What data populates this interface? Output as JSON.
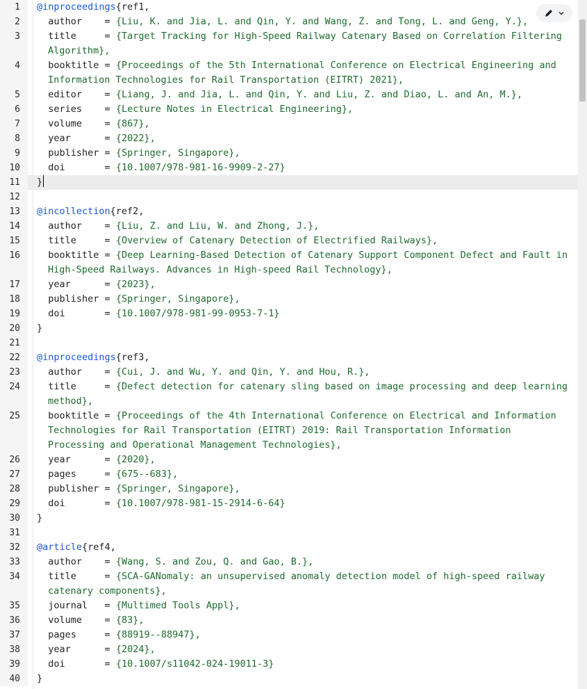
{
  "lines": [
    {
      "n": "1",
      "segs": [
        [
          "tag",
          "@inproceedings"
        ],
        [
          "brace",
          "{ref1,"
        ]
      ]
    },
    {
      "n": "2",
      "segs": [
        [
          "key",
          "  author    "
        ],
        [
          "brace",
          "= "
        ],
        [
          "val",
          "{Liu, K. and Jia, L. and Qin, Y. and Wang, Z. and Tong, L. and Geng, Y.},"
        ]
      ]
    },
    {
      "n": "3",
      "segs": [
        [
          "key",
          "  title     "
        ],
        [
          "brace",
          "= "
        ],
        [
          "val",
          "{Target Tracking for High-Speed Railway Catenary Based on Correlation Filtering"
        ]
      ]
    },
    {
      "n": "",
      "cont": true,
      "segs": [
        [
          "val",
          "Algorithm},"
        ]
      ]
    },
    {
      "n": "4",
      "segs": [
        [
          "key",
          "  booktitle "
        ],
        [
          "brace",
          "= "
        ],
        [
          "val",
          "{Proceedings of the 5th International Conference on Electrical Engineering and"
        ]
      ]
    },
    {
      "n": "",
      "cont": true,
      "segs": [
        [
          "val",
          "Information Technologies for Rail Transportation (EITRT) 2021},"
        ]
      ]
    },
    {
      "n": "5",
      "segs": [
        [
          "key",
          "  editor    "
        ],
        [
          "brace",
          "= "
        ],
        [
          "val",
          "{Liang, J. and Jia, L. and Qin, Y. and Liu, Z. and Diao, L. and An, M.},"
        ]
      ]
    },
    {
      "n": "6",
      "segs": [
        [
          "key",
          "  series    "
        ],
        [
          "brace",
          "= "
        ],
        [
          "val",
          "{Lecture Notes in Electrical Engineering},"
        ]
      ]
    },
    {
      "n": "7",
      "segs": [
        [
          "key",
          "  volume    "
        ],
        [
          "brace",
          "= "
        ],
        [
          "val",
          "{867},"
        ]
      ]
    },
    {
      "n": "8",
      "segs": [
        [
          "key",
          "  year      "
        ],
        [
          "brace",
          "= "
        ],
        [
          "val",
          "{2022},"
        ]
      ]
    },
    {
      "n": "9",
      "segs": [
        [
          "key",
          "  publisher "
        ],
        [
          "brace",
          "= "
        ],
        [
          "val",
          "{Springer, Singapore},"
        ]
      ]
    },
    {
      "n": "10",
      "segs": [
        [
          "key",
          "  doi       "
        ],
        [
          "brace",
          "= "
        ],
        [
          "val",
          "{10.1007/978-981-16-9909-2-27}"
        ]
      ]
    },
    {
      "n": "11",
      "active": true,
      "cursor": true,
      "segs": [
        [
          "brace",
          "}"
        ]
      ]
    },
    {
      "n": "12",
      "segs": []
    },
    {
      "n": "13",
      "segs": [
        [
          "tag",
          "@incollection"
        ],
        [
          "brace",
          "{ref2,"
        ]
      ]
    },
    {
      "n": "14",
      "segs": [
        [
          "key",
          "  author    "
        ],
        [
          "brace",
          "= "
        ],
        [
          "val",
          "{Liu, Z. and Liu, W. and Zhong, J.},"
        ]
      ]
    },
    {
      "n": "15",
      "segs": [
        [
          "key",
          "  title     "
        ],
        [
          "brace",
          "= "
        ],
        [
          "val",
          "{Overview of Catenary Detection of Electrified Railways},"
        ]
      ]
    },
    {
      "n": "16",
      "segs": [
        [
          "key",
          "  booktitle "
        ],
        [
          "brace",
          "= "
        ],
        [
          "val",
          "{Deep Learning-Based Detection of Catenary Support Component Defect and Fault in"
        ]
      ]
    },
    {
      "n": "",
      "cont": true,
      "segs": [
        [
          "val",
          "High-Speed Railways. Advances in High-speed Rail Technology},"
        ]
      ]
    },
    {
      "n": "17",
      "segs": [
        [
          "key",
          "  year      "
        ],
        [
          "brace",
          "= "
        ],
        [
          "val",
          "{2023},"
        ]
      ]
    },
    {
      "n": "18",
      "segs": [
        [
          "key",
          "  publisher "
        ],
        [
          "brace",
          "= "
        ],
        [
          "val",
          "{Springer, Singapore},"
        ]
      ]
    },
    {
      "n": "19",
      "segs": [
        [
          "key",
          "  doi       "
        ],
        [
          "brace",
          "= "
        ],
        [
          "val",
          "{10.1007/978-981-99-0953-7-1}"
        ]
      ]
    },
    {
      "n": "20",
      "segs": [
        [
          "brace",
          "}"
        ]
      ]
    },
    {
      "n": "21",
      "segs": []
    },
    {
      "n": "22",
      "segs": [
        [
          "tag",
          "@inproceedings"
        ],
        [
          "brace",
          "{ref3,"
        ]
      ]
    },
    {
      "n": "23",
      "segs": [
        [
          "key",
          "  author    "
        ],
        [
          "brace",
          "= "
        ],
        [
          "val",
          "{Cui, J. and Wu, Y. and Qin, Y. and Hou, R.},"
        ]
      ]
    },
    {
      "n": "24",
      "segs": [
        [
          "key",
          "  title     "
        ],
        [
          "brace",
          "= "
        ],
        [
          "val",
          "{Defect detection for catenary sling based on image processing and deep learning"
        ]
      ]
    },
    {
      "n": "",
      "cont": true,
      "segs": [
        [
          "val",
          "method},"
        ]
      ]
    },
    {
      "n": "25",
      "segs": [
        [
          "key",
          "  booktitle "
        ],
        [
          "brace",
          "= "
        ],
        [
          "val",
          "{Proceedings of the 4th International Conference on Electrical and Information"
        ]
      ]
    },
    {
      "n": "",
      "cont": true,
      "segs": [
        [
          "val",
          "Technologies for Rail Transportation (EITRT) 2019: Rail Transportation Information"
        ]
      ]
    },
    {
      "n": "",
      "cont": true,
      "segs": [
        [
          "val",
          "Processing and Operational Management Technologies},"
        ]
      ]
    },
    {
      "n": "26",
      "segs": [
        [
          "key",
          "  year      "
        ],
        [
          "brace",
          "= "
        ],
        [
          "val",
          "{2020},"
        ]
      ]
    },
    {
      "n": "27",
      "segs": [
        [
          "key",
          "  pages     "
        ],
        [
          "brace",
          "= "
        ],
        [
          "val",
          "{675--683},"
        ]
      ]
    },
    {
      "n": "28",
      "segs": [
        [
          "key",
          "  publisher "
        ],
        [
          "brace",
          "= "
        ],
        [
          "val",
          "{Springer, Singapore},"
        ]
      ]
    },
    {
      "n": "29",
      "segs": [
        [
          "key",
          "  doi       "
        ],
        [
          "brace",
          "= "
        ],
        [
          "val",
          "{10.1007/978-981-15-2914-6-64}"
        ]
      ]
    },
    {
      "n": "30",
      "segs": [
        [
          "brace",
          "}"
        ]
      ]
    },
    {
      "n": "31",
      "segs": []
    },
    {
      "n": "32",
      "segs": [
        [
          "tag",
          "@article"
        ],
        [
          "brace",
          "{ref4,"
        ]
      ]
    },
    {
      "n": "33",
      "segs": [
        [
          "key",
          "  author    "
        ],
        [
          "brace",
          "= "
        ],
        [
          "val",
          "{Wang, S. and Zou, Q. and Gao, B.},"
        ]
      ]
    },
    {
      "n": "34",
      "segs": [
        [
          "key",
          "  title     "
        ],
        [
          "brace",
          "= "
        ],
        [
          "val",
          "{SCA-GANomaly: an unsupervised anomaly detection model of high-speed railway"
        ]
      ]
    },
    {
      "n": "",
      "cont": true,
      "segs": [
        [
          "val",
          "catenary components},"
        ]
      ]
    },
    {
      "n": "35",
      "segs": [
        [
          "key",
          "  journal   "
        ],
        [
          "brace",
          "= "
        ],
        [
          "val",
          "{Multimed Tools Appl},"
        ]
      ]
    },
    {
      "n": "36",
      "segs": [
        [
          "key",
          "  volume    "
        ],
        [
          "brace",
          "= "
        ],
        [
          "val",
          "{83},"
        ]
      ]
    },
    {
      "n": "37",
      "segs": [
        [
          "key",
          "  pages     "
        ],
        [
          "brace",
          "= "
        ],
        [
          "val",
          "{88919--88947},"
        ]
      ]
    },
    {
      "n": "38",
      "segs": [
        [
          "key",
          "  year      "
        ],
        [
          "brace",
          "= "
        ],
        [
          "val",
          "{2024},"
        ]
      ]
    },
    {
      "n": "39",
      "segs": [
        [
          "key",
          "  doi       "
        ],
        [
          "brace",
          "= "
        ],
        [
          "val",
          "{10.1007/s11042-024-19011-3}"
        ]
      ]
    },
    {
      "n": "40",
      "segs": [
        [
          "brace",
          "}"
        ]
      ]
    }
  ],
  "toolbar": {
    "edit_icon": "pencil-icon",
    "menu_icon": "chevron-down-icon"
  }
}
